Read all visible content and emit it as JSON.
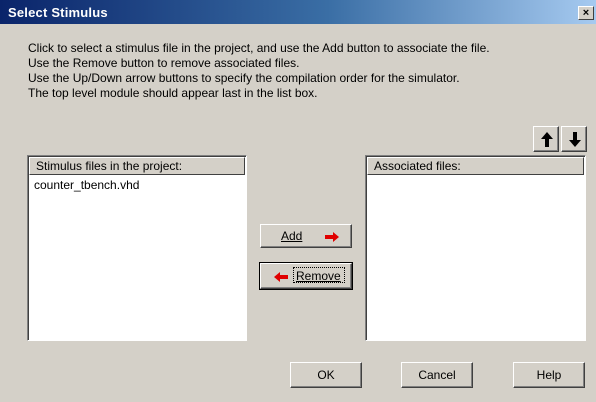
{
  "window": {
    "title": "Select Stimulus",
    "close_label": "×"
  },
  "instructions": [
    "Click to select a stimulus file in the project, and use the Add button to associate the file.",
    "Use the Remove button to remove associated files.",
    "Use the Up/Down arrow buttons to specify the compilation order for the simulator.",
    "The top level module should appear last in the list box."
  ],
  "left_list": {
    "header": "Stimulus files in the project:",
    "items": [
      "counter_tbench.vhd"
    ]
  },
  "right_list": {
    "header": "Associated files:",
    "items": []
  },
  "buttons": {
    "add": "Add",
    "remove": "Remove",
    "ok": "OK",
    "cancel": "Cancel",
    "help": "Help"
  },
  "icons": {
    "up": "arrow-up-icon",
    "down": "arrow-down-icon",
    "add_arrow": "red-arrow-right-icon",
    "remove_arrow": "red-arrow-left-icon"
  },
  "colors": {
    "arrow_red": "#e00000",
    "title_start": "#0a246a",
    "title_end": "#a6caf0",
    "face": "#d4d0c8"
  }
}
